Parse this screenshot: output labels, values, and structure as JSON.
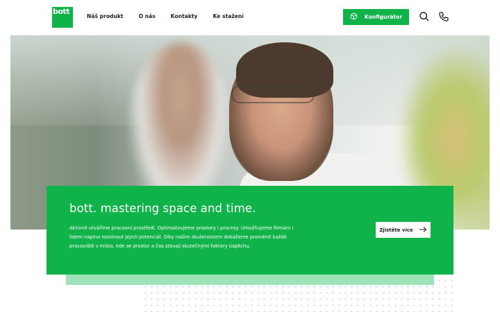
{
  "logo": {
    "text": "bott"
  },
  "nav": {
    "items": [
      {
        "label": "Náš produkt"
      },
      {
        "label": "O nás"
      },
      {
        "label": "Kontakty"
      },
      {
        "label": "Ke stažení"
      }
    ]
  },
  "header": {
    "config_label": "Konfigurátor",
    "icons": [
      "cube-icon",
      "search-icon",
      "phone-icon"
    ]
  },
  "hero": {
    "title": "bott. mastering space and time.",
    "text": "Aktivně utváříme pracovní prostředí. Optimalizujeme prostory i procesy. Umožňujeme firmám i lidem naplno rozvinout jejich potenciál. Díky našim zkušenostem dokážeme proměnit každé pracoviště v místo, kde se prostor a čas stávají skutečnými faktory úspěchu.",
    "button_label": "Zjistěte více",
    "button_icon": "arrow-right-icon"
  },
  "colors": {
    "brand_green": "#10b24a",
    "mint": "#9fe3b8"
  }
}
